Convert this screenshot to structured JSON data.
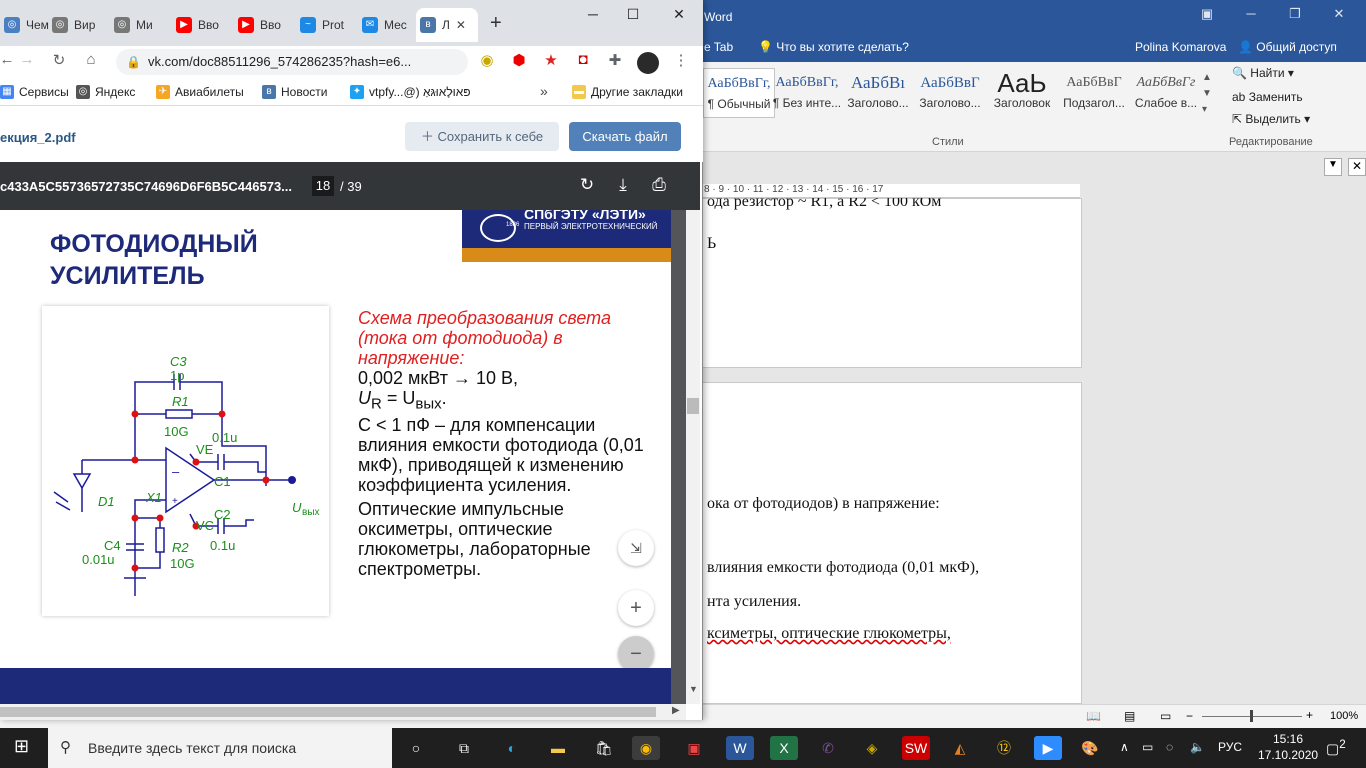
{
  "word": {
    "title": "Word",
    "tell_me": "Что вы хотите сделать?",
    "ribbon_tab_partial": "e Tab",
    "user": "Polina Komarova",
    "share": "Общий доступ",
    "styles": [
      {
        "preview": "АаБбВвГг,",
        "name": "¶ Обычный"
      },
      {
        "preview": "АаБбВвГг,",
        "name": "¶ Без инте..."
      },
      {
        "preview": "АаБбВı",
        "name": "Заголово..."
      },
      {
        "preview": "АаБбВвГ",
        "name": "Заголово..."
      },
      {
        "preview": "АаЬ",
        "name": "Заголовок"
      },
      {
        "preview": "АаБбВвГ",
        "name": "Подзагол..."
      },
      {
        "preview": "АаБбВвГг",
        "name": "Слабое в..."
      }
    ],
    "styles_group_label": "Стили",
    "editing": {
      "find": "Найти",
      "replace": "Заменить",
      "select": "Выделить",
      "label": "Редактирование"
    },
    "ruler_marks": "8 · 9 · 10 · 11 · 12 · 13 · 14 · 15 · 16 · 17",
    "page1_lines": [
      "ода резистор ~ R1, а R2 < 100 кОм",
      "Ь"
    ],
    "page2_lines": [
      "ока от фотодиодов) в напряжение:",
      "влияния емкости фотодиода (0,01 мкФ),",
      "нта усиления.",
      "ксиметры,    оптические    глюкометры,"
    ],
    "zoom": "100%"
  },
  "chrome": {
    "tabs": [
      {
        "label": "Чем",
        "color": "#4a7fc1",
        "glyph": "🌐"
      },
      {
        "label": "Вир",
        "color": "#777777",
        "glyph": "🌐"
      },
      {
        "label": "Ми",
        "color": "#777777",
        "glyph": "🌐"
      },
      {
        "label": "Вво",
        "color": "#ff0000",
        "glyph": "▶"
      },
      {
        "label": "Вво",
        "color": "#ff0000",
        "glyph": "▶"
      },
      {
        "label": "Prot",
        "color": "#1e88e5",
        "glyph": "~"
      },
      {
        "label": "Мес",
        "color": "#1e88e5",
        "glyph": "✉"
      },
      {
        "label": "Л",
        "color": "#4a76a8",
        "glyph": "vk"
      }
    ],
    "new_tab": "+",
    "url": "vk.com/doc88511296_574286235?hash=e6...",
    "bookmarks": [
      "Сервисы",
      "Яндекс",
      "Авиабилеты",
      "Новости",
      "vtpfy...@) פּאוּלָאוּגּאַ",
      "Другие закладки"
    ],
    "bookmarks_more": "»"
  },
  "vk": {
    "filename": "екция_2.pdf",
    "save": "Сохранить к себе",
    "download": "Скачать файл"
  },
  "pdf": {
    "name": "c433A5C55736572735C74696D6F6B5C446573...",
    "page": "18",
    "total": "/ 39"
  },
  "slide": {
    "university": "СПбГЭТУ «ЛЭТИ»",
    "university_sub": "ПЕРВЫЙ ЭЛЕКТРОТЕХНИЧЕСКИЙ",
    "year": "1886",
    "title_line1": "ФОТОДИОДНЫЙ",
    "title_line2": "УСИЛИТЕЛЬ",
    "red_text": "Схема преобразования света (тока от фотодиода) в напряжение:",
    "line1": "0,002 мкВт → 10 В,",
    "line2_u": "U",
    "line2_sub": "R",
    "line2_eq": " = U",
    "line2_sub2": "вых",
    "line2_end": ".",
    "line3": "C < 1 пФ – для компенсации влияния емкости фотодиода (0,01 мкФ), приводящей к изменению коэффициента усиления.",
    "line4": "Оптические импульсные оксиметры, оптические глюкометры, лабораторные спектрометры.",
    "circuit": {
      "c3": "C3",
      "c3v": "1p",
      "r1": "R1",
      "r1v": "10G",
      "ve": "VE",
      "c1v": "0.1u",
      "c1": "C1",
      "c2": "C2",
      "c2v": "0.1u",
      "vc": "VC",
      "d1": "D1",
      "x1": "X1",
      "c4": "C4",
      "c4v": "0.01u",
      "r2": "R2",
      "r2v": "10G",
      "uout": "U",
      "uout_sub": "вых",
      "minus": "–",
      "plus": "+"
    }
  },
  "taskbar": {
    "search": "Введите здесь текст для поиска",
    "lang": "РУС",
    "time": "15:16",
    "date": "17.10.2020",
    "notif": "2"
  }
}
